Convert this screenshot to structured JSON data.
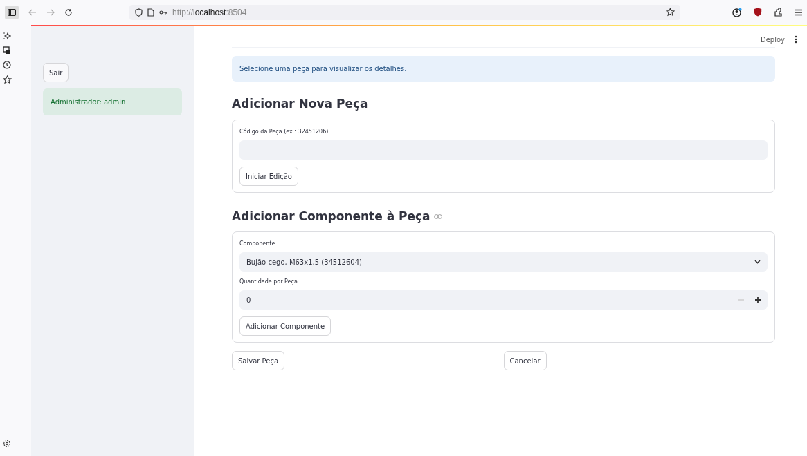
{
  "browser": {
    "url": {
      "scheme": "http://",
      "host": "localhost",
      "port": ":8504"
    }
  },
  "sidebar": {
    "logout_button": "Sair",
    "user_notice": "Administrador: admin"
  },
  "header": {
    "deploy": "Deploy"
  },
  "info_message": "Selecione uma peça para visualizar os detalhes.",
  "new_part": {
    "title": "Adicionar Nova Peça",
    "code_label": "Código da Peça (ex.: 32451206)",
    "start_button": "Iniciar Edição"
  },
  "add_component": {
    "title": "Adicionar Componente à Peça",
    "component_label": "Componente",
    "component_value": "Bujão cego, M63x1,5 (34512604)",
    "quantity_label": "Quantidade por Peça",
    "quantity_value": "0",
    "decrement_disabled": true,
    "add_button": "Adicionar Componente"
  },
  "actions": {
    "save": "Salvar Peça",
    "cancel": "Cancelar"
  }
}
